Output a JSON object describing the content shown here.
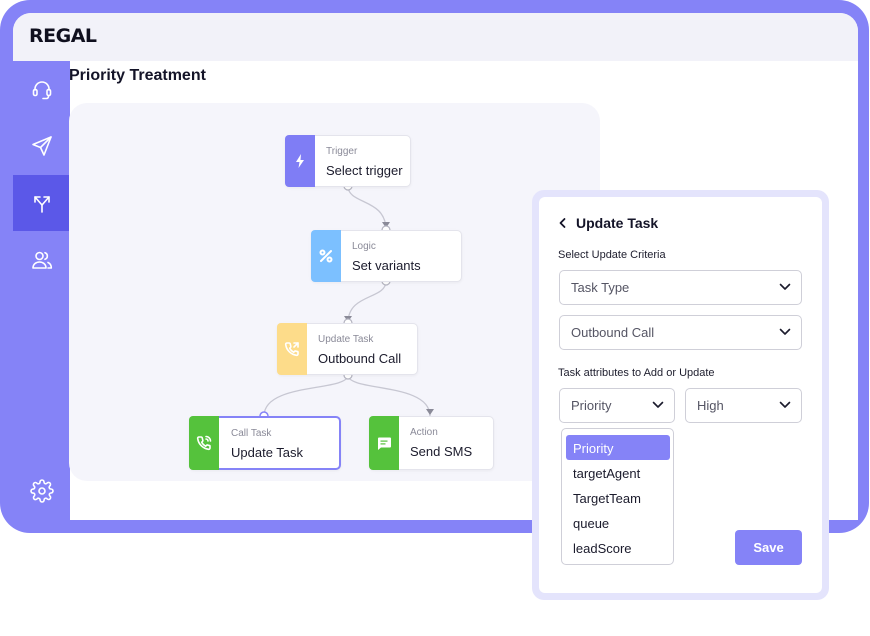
{
  "app": {
    "logo": "REGAL"
  },
  "sidebar": {
    "items": [
      {
        "icon": "headset-icon"
      },
      {
        "icon": "send-icon"
      },
      {
        "icon": "split-arrows-icon",
        "active": true
      },
      {
        "icon": "users-icon"
      },
      {
        "icon": "gear-icon"
      }
    ]
  },
  "page": {
    "title": "Priority Treatment"
  },
  "flow": {
    "nodes": [
      {
        "kind": "Trigger",
        "name": "Select trigger",
        "icon": "lightning-icon",
        "color": "#7f7df5"
      },
      {
        "kind": "Logic",
        "name": "Set variants",
        "icon": "percent-icon",
        "color": "#7cc0ff"
      },
      {
        "kind": "Update Task",
        "name": "Outbound Call",
        "icon": "phone-outgoing-icon",
        "color": "#fddc8a"
      },
      {
        "kind": "Call Task",
        "name": "Update Task",
        "icon": "phone-call-icon",
        "color": "#55c23c"
      },
      {
        "kind": "Action",
        "name": "Send SMS",
        "icon": "message-icon",
        "color": "#55c23c"
      }
    ]
  },
  "panel": {
    "title": "Update Task",
    "criteria_label": "Select Update Criteria",
    "criteria_select_1": "Task Type",
    "criteria_select_2": "Outbound Call",
    "attributes_label": "Task attributes to Add or Update",
    "attribute_select": "Priority",
    "value_select": "High",
    "attribute_options": [
      "Priority",
      "targetAgent",
      "TargetTeam",
      "queue",
      "leadScore"
    ],
    "selected_option": "Priority",
    "save_label": "Save"
  },
  "colors": {
    "accent": "#8583f7",
    "accent_dark": "#5b58e8",
    "panel_border": "#e4e4fc"
  }
}
